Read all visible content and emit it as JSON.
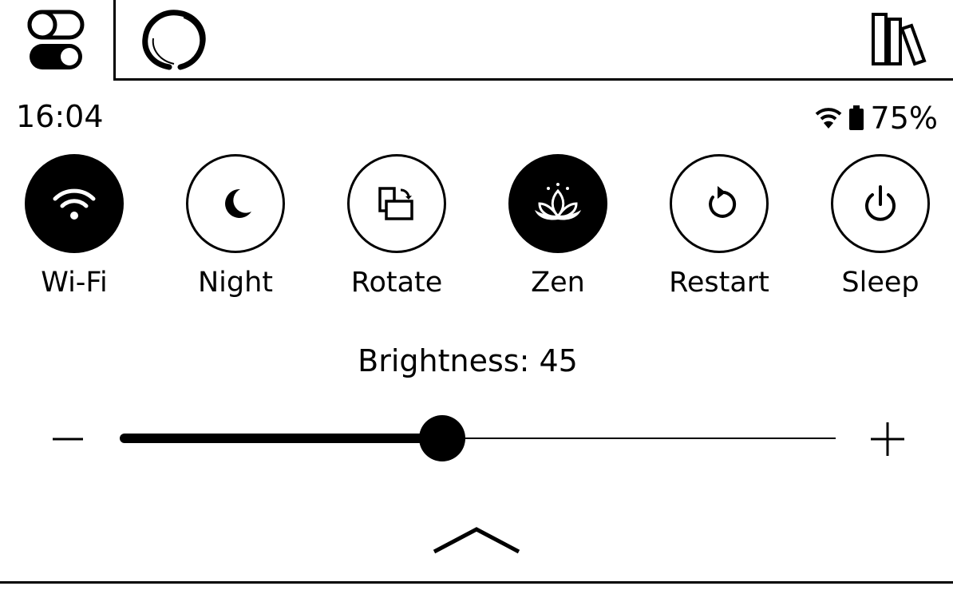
{
  "topbar": {
    "tabs": [
      {
        "name": "quick-settings-tab",
        "icon": "toggles-icon",
        "active": true
      },
      {
        "name": "zen-tab",
        "icon": "enso-circle-icon",
        "active": false
      }
    ],
    "library_icon": "books-library-icon"
  },
  "status": {
    "time": "16:04",
    "battery": "75%",
    "wifi_icon": "wifi-icon",
    "battery_icon": "battery-icon"
  },
  "toggles": [
    {
      "label": "Wi-Fi",
      "icon": "wifi-icon",
      "active": true
    },
    {
      "label": "Night",
      "icon": "moon-icon",
      "active": false
    },
    {
      "label": "Rotate",
      "icon": "rotate-icon",
      "active": false
    },
    {
      "label": "Zen",
      "icon": "lotus-icon",
      "active": true
    },
    {
      "label": "Restart",
      "icon": "restart-icon",
      "active": false
    },
    {
      "label": "Sleep",
      "icon": "power-icon",
      "active": false
    }
  ],
  "brightness": {
    "label": "Brightness: 45",
    "value": 45,
    "min": 0,
    "max": 100,
    "decrease_icon": "minus-icon",
    "increase_icon": "plus-icon"
  },
  "collapse_icon": "chevron-up-icon"
}
